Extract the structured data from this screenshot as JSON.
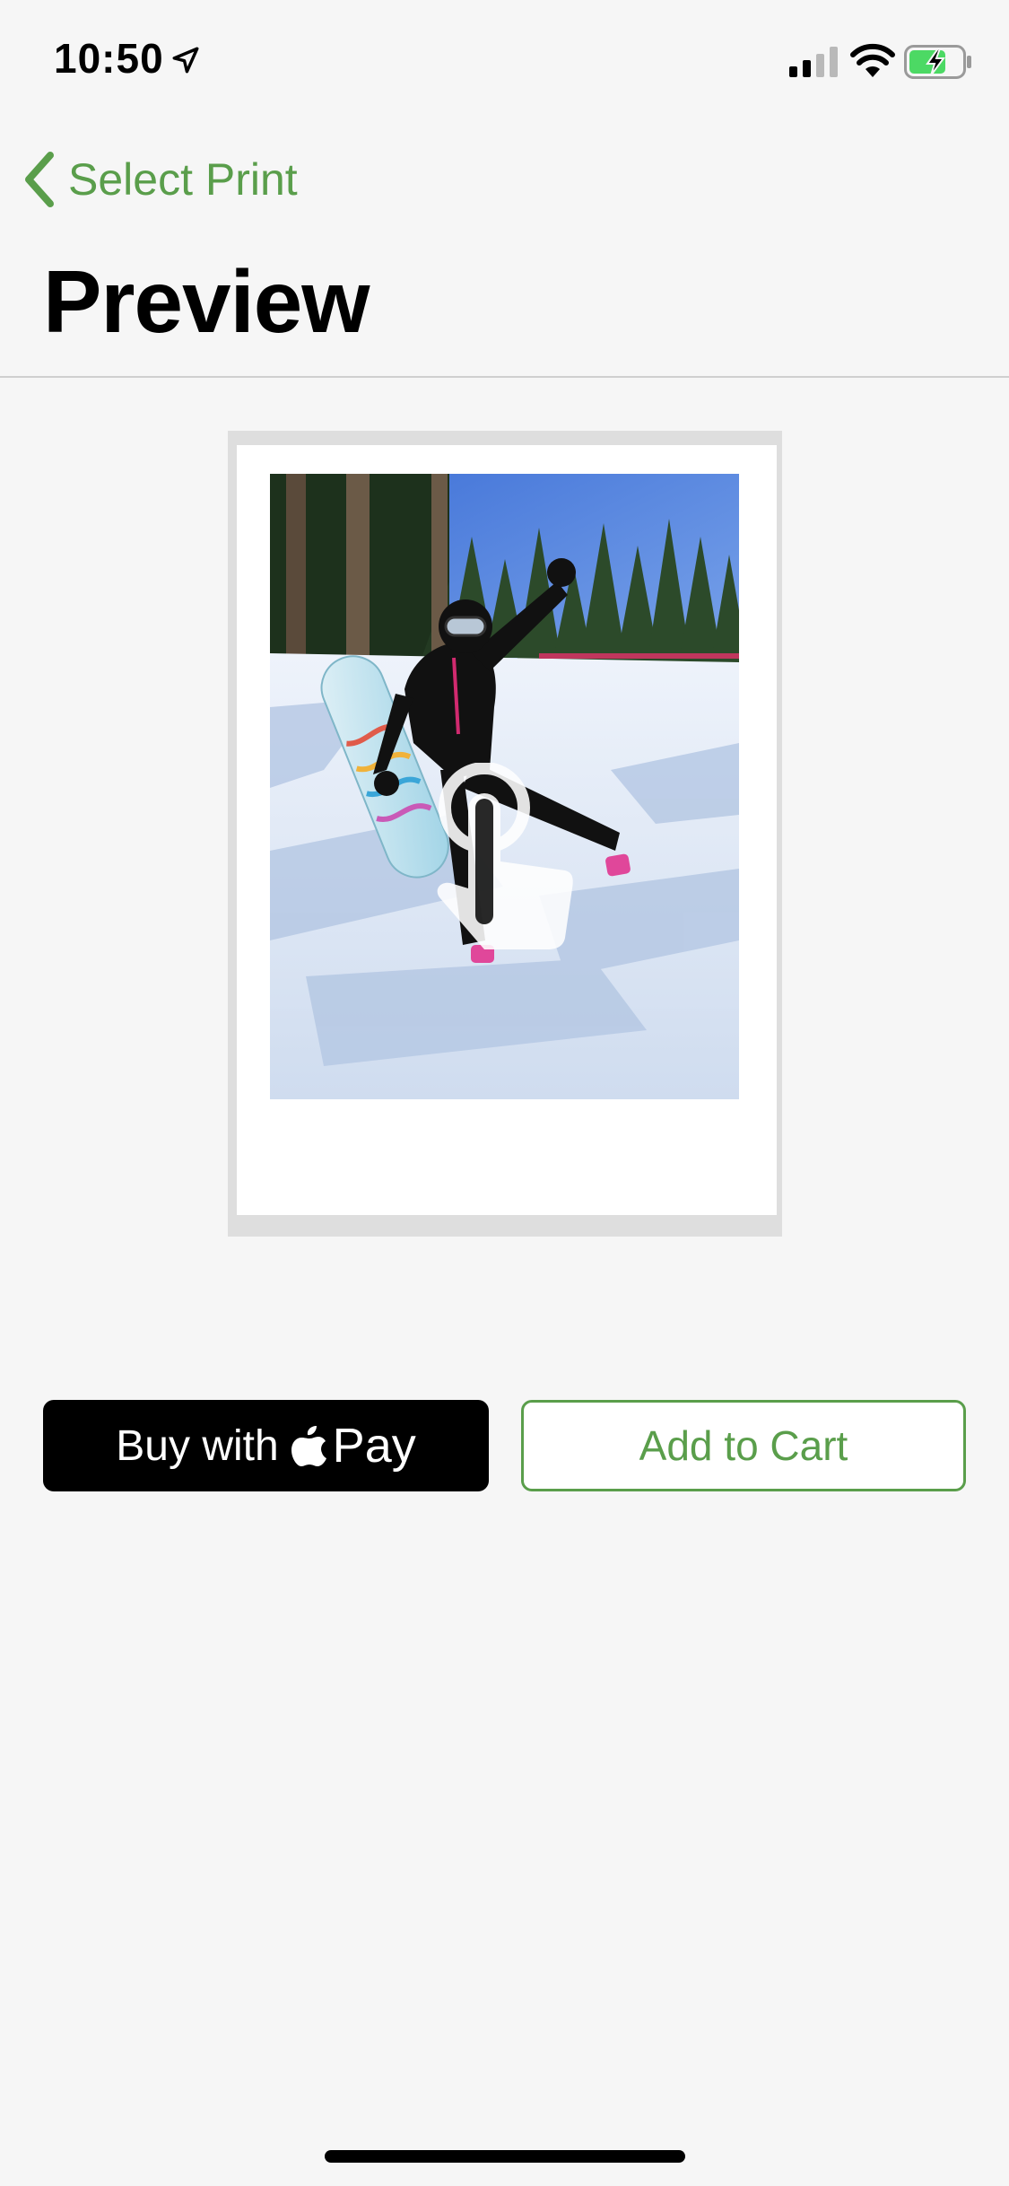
{
  "status_bar": {
    "time": "10:50",
    "icons": [
      "location-arrow-icon",
      "cellular-signal-icon",
      "wifi-icon",
      "battery-charging-icon"
    ]
  },
  "nav": {
    "back_label": "Select Print",
    "title": "Preview"
  },
  "preview": {
    "photo_description_icon": "tap-gesture-icon"
  },
  "actions": {
    "apple_pay_prefix": "Buy with",
    "apple_pay_word": "Pay",
    "add_to_cart": "Add to Cart"
  },
  "colors": {
    "accent": "#5a9e4b",
    "background": "#f6f6f6",
    "apple_pay_bg": "#000000"
  }
}
